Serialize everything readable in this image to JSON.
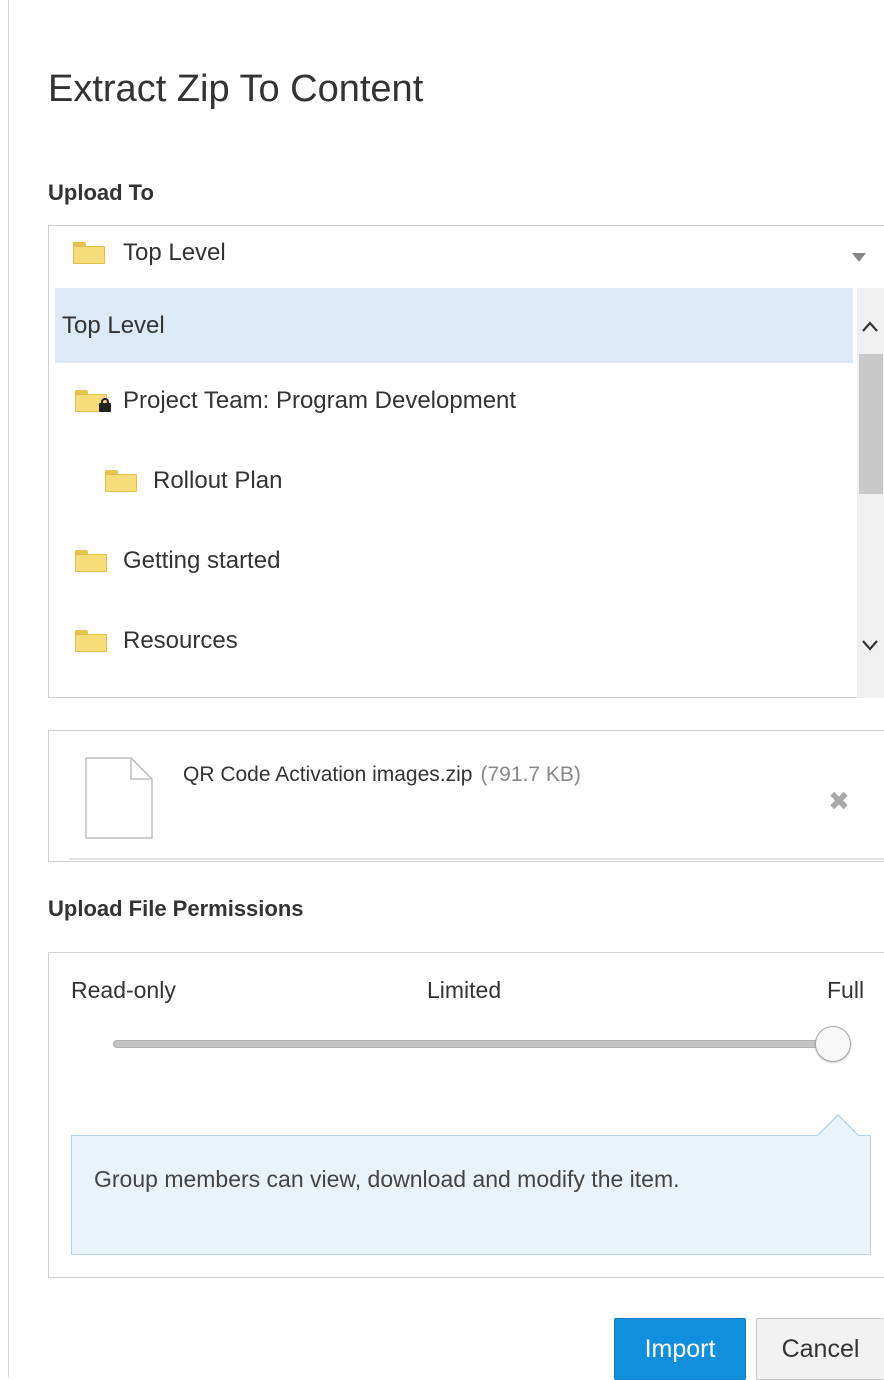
{
  "dialog": {
    "title": "Extract Zip To Content"
  },
  "upload_to": {
    "label": "Upload To",
    "selected": "Top Level",
    "items": [
      {
        "label": "Top Level",
        "selected": true,
        "icon": "none"
      },
      {
        "label": "Project Team: Program Development",
        "icon": "locked-folder-icon"
      },
      {
        "label": "Rollout Plan",
        "icon": "folder-icon"
      },
      {
        "label": "Getting started",
        "icon": "folder-icon"
      },
      {
        "label": "Resources",
        "icon": "folder-icon"
      }
    ]
  },
  "file": {
    "name": "QR Code Activation images.zip",
    "size": "(791.7 KB)",
    "remove_icon": "close-icon"
  },
  "permissions": {
    "label": "Upload File Permissions",
    "options": [
      "Read-only",
      "Limited",
      "Full"
    ],
    "selected": "Full",
    "level": 1.0,
    "description": "Group members can view, download and modify the item."
  },
  "buttons": {
    "import": "Import",
    "cancel": "Cancel"
  },
  "colors": {
    "primary": "#0f8fdc",
    "selection": "#dde9f5",
    "info_bg": "#eaf3fa",
    "folder": "#f7dc7a"
  }
}
